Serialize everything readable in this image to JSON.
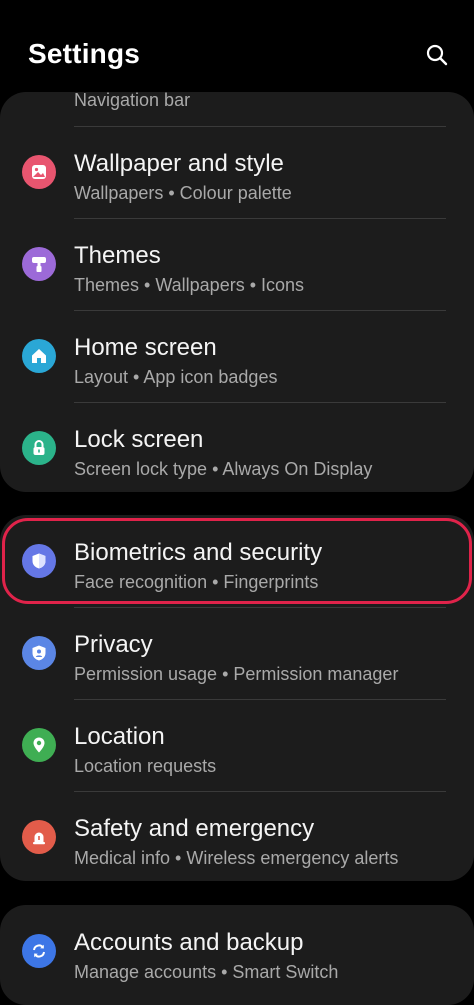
{
  "header": {
    "title": "Settings",
    "search_icon": "search-icon"
  },
  "colors": {
    "background": "#000000",
    "card": "#1c1c1c",
    "highlight": "#e0234a",
    "wallpaper": "#e8556f",
    "themes": "#9c6ad8",
    "home": "#2aa7d6",
    "lock": "#2bb38a",
    "biometrics": "#6577e6",
    "privacy": "#5b86e5",
    "location": "#3fae53",
    "safety": "#e25c4a",
    "accounts": "#3d76e6"
  },
  "card1": {
    "partial_label": "Navigation bar",
    "items": [
      {
        "label": "Wallpaper and style",
        "sub": "Wallpapers • Colour palette",
        "icon": "image-icon"
      },
      {
        "label": "Themes",
        "sub": "Themes • Wallpapers • Icons",
        "icon": "paint-roller-icon"
      },
      {
        "label": "Home screen",
        "sub": "Layout • App icon badges",
        "icon": "home-icon"
      },
      {
        "label": "Lock screen",
        "sub": "Screen lock type • Always On Display",
        "icon": "lock-icon"
      }
    ]
  },
  "card2": {
    "items": [
      {
        "label": "Biometrics and security",
        "sub": "Face recognition • Fingerprints",
        "icon": "shield-icon"
      },
      {
        "label": "Privacy",
        "sub": "Permission usage • Permission manager",
        "icon": "privacy-shield-icon"
      },
      {
        "label": "Location",
        "sub": "Location requests",
        "icon": "location-pin-icon"
      },
      {
        "label": "Safety and emergency",
        "sub": "Medical info • Wireless emergency alerts",
        "icon": "emergency-icon"
      }
    ]
  },
  "card3": {
    "items": [
      {
        "label": "Accounts and backup",
        "sub": "Manage accounts • Smart Switch",
        "icon": "sync-icon"
      }
    ]
  }
}
